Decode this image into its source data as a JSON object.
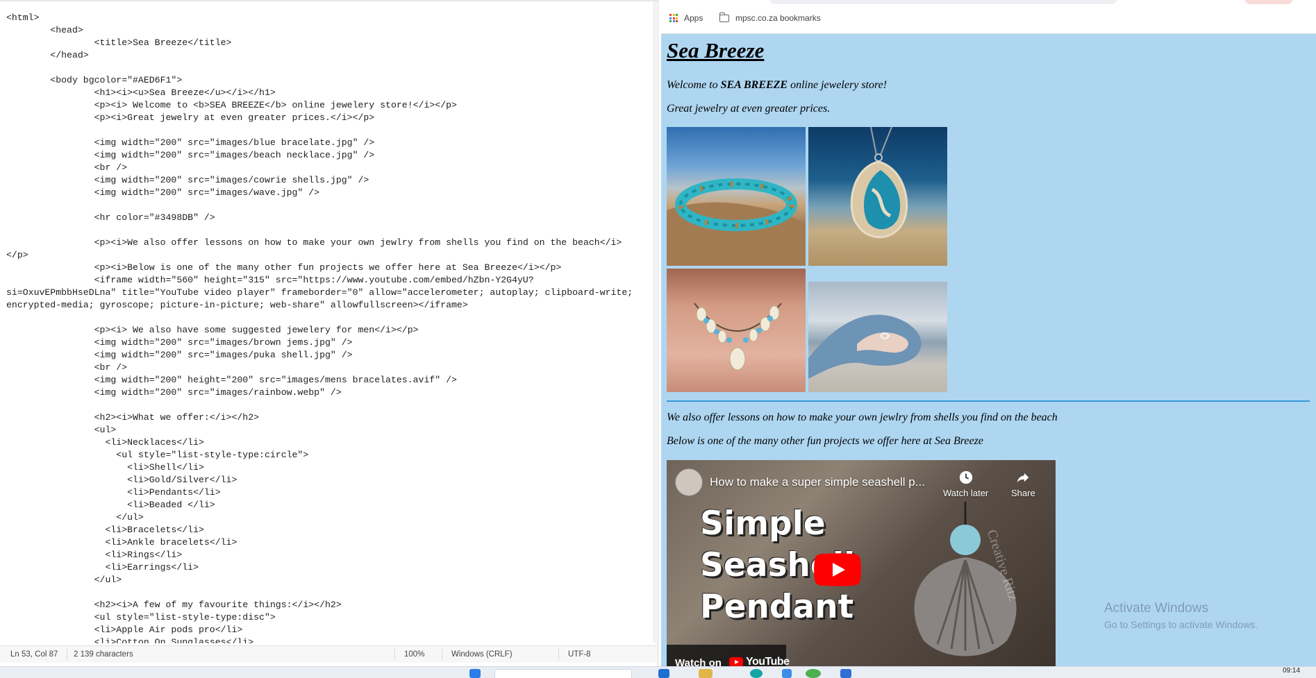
{
  "editor": {
    "code_lines": [
      "<html>",
      "        <head>",
      "                <title>Sea Breeze</title>",
      "        </head>",
      "",
      "        <body bgcolor=\"#AED6F1\">",
      "                <h1><i><u>Sea Breeze</u></i></h1>",
      "                <p><i> Welcome to <b>SEA BREEZE</b> online jewelery store!</i></p>",
      "                <p><i>Great jewelry at even greater prices.</i></p>",
      "",
      "                <img width=\"200\" src=\"images/blue bracelate.jpg\" />",
      "                <img width=\"200\" src=\"images/beach necklace.jpg\" />",
      "                <br />",
      "                <img width=\"200\" src=\"images/cowrie shells.jpg\" />",
      "                <img width=\"200\" src=\"images/wave.jpg\" />",
      "",
      "                <hr color=\"#3498DB\" />",
      "",
      "                <p><i>We also offer lessons on how to make your own jewlry from shells you find on the beach</i>",
      "</p>",
      "                <p><i>Below is one of the many other fun projects we offer here at Sea Breeze</i></p>",
      "                <iframe width=\"560\" height=\"315\" src=\"https://www.youtube.com/embed/hZbn-Y2G4yU?",
      "si=OxuvEPmbbHseDLna\" title=\"YouTube video player\" frameborder=\"0\" allow=\"accelerometer; autoplay; clipboard-write;",
      "encrypted-media; gyroscope; picture-in-picture; web-share\" allowfullscreen></iframe>",
      "",
      "                <p><i> We also have some suggested jewelery for men</i></p>",
      "                <img width=\"200\" src=\"images/brown jems.jpg\" />",
      "                <img width=\"200\" src=\"images/puka shell.jpg\" />",
      "                <br />",
      "                <img width=\"200\" height=\"200\" src=\"images/mens bracelates.avif\" />",
      "                <img width=\"200\" src=\"images/rainbow.webp\" />",
      "",
      "                <h2><i>What we offer:</i></h2>",
      "                <ul>",
      "                  <li>Necklaces</li>",
      "                    <ul style=\"list-style-type:circle\">",
      "                      <li>Shell</li>",
      "                      <li>Gold/Silver</li>",
      "                      <li>Pendants</li>",
      "                      <li>Beaded </li>",
      "                    </ul>",
      "                  <li>Bracelets</li>",
      "                  <li>Ankle bracelets</li>",
      "                  <li>Rings</li>",
      "                  <li>Earrings</li>",
      "                </ul>",
      "",
      "                <h2><i>A few of my favourite things:</i></h2>",
      "                <ul style=\"list-style-type:disc\">",
      "                <li>Apple Air pods pro</li>",
      "                <li>Cotton On Sunglasses</li>"
    ],
    "status": {
      "position": "Ln 53, Col 87",
      "characters": "2 139 characters",
      "zoom": "100%",
      "line_ending": "Windows (CRLF)",
      "encoding": "UTF-8"
    }
  },
  "browser": {
    "bookmarks": [
      {
        "label": "Apps",
        "icon": "apps-grid-icon"
      },
      {
        "label": "mpsc.co.za bookmarks",
        "icon": "folder-icon"
      }
    ],
    "page": {
      "title": "Sea Breeze",
      "welcome_pre": "Welcome to ",
      "welcome_bold": "SEA BREEZE",
      "welcome_post": " online jewelery store!",
      "tagline": "Great jewelry at even greater prices.",
      "hr_color": "#3498DB",
      "lessons": "We also offer lessons on how to make your own jewlry from shells you find on the beach",
      "projects": "Below is one of the many other fun projects we offer here at Sea Breeze",
      "background": "#AED6F1"
    },
    "video": {
      "title": "How to make a super simple seashell p...",
      "watch_later": "Watch later",
      "share": "Share",
      "overlay_lines": [
        "Simple",
        "Seashell",
        "Pendant"
      ],
      "watch_on": "Watch on",
      "youtube": "YouTube",
      "watermark": "Creative Ritz"
    }
  },
  "windows_notice": {
    "line1": "Activate Windows",
    "line2": "Go to Settings to activate Windows."
  },
  "taskbar": {
    "clock": "09:14"
  }
}
